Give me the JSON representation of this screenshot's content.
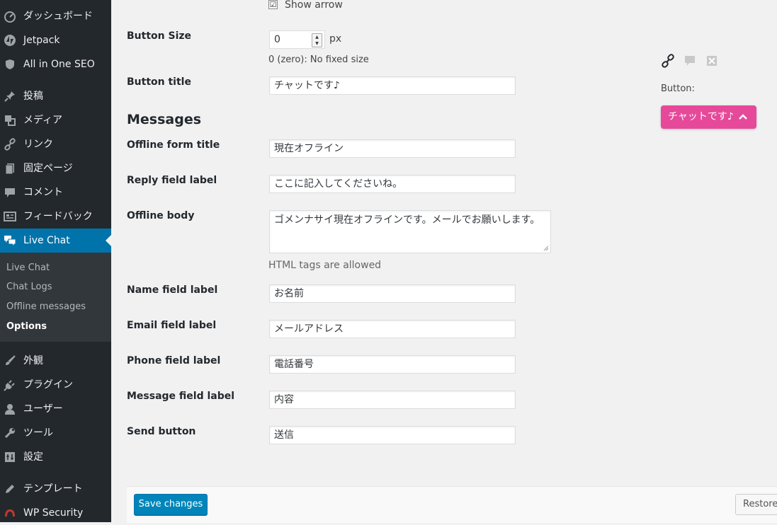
{
  "sidebar": {
    "items": [
      {
        "label": "ダッシュボード",
        "icon": "dashboard-icon"
      },
      {
        "label": "Jetpack",
        "icon": "jetpack-icon"
      },
      {
        "label": "All in One SEO",
        "icon": "shield-icon"
      },
      {
        "label": "投稿",
        "icon": "pushpin-icon"
      },
      {
        "label": "メディア",
        "icon": "media-icon"
      },
      {
        "label": "リンク",
        "icon": "link-icon"
      },
      {
        "label": "固定ページ",
        "icon": "page-icon"
      },
      {
        "label": "コメント",
        "icon": "comment-icon"
      },
      {
        "label": "フィードバック",
        "icon": "feedback-icon"
      },
      {
        "label": "Live Chat",
        "icon": "chat-bubbles-icon"
      },
      {
        "label": "外観",
        "icon": "brush-icon"
      },
      {
        "label": "プラグイン",
        "icon": "plug-icon"
      },
      {
        "label": "ユーザー",
        "icon": "user-icon"
      },
      {
        "label": "ツール",
        "icon": "wrench-icon"
      },
      {
        "label": "設定",
        "icon": "settings-icon"
      },
      {
        "label": "テンプレート",
        "icon": "pen-icon"
      },
      {
        "label": "WP Security",
        "icon": "security-icon"
      }
    ],
    "submenu": [
      "Live Chat",
      "Chat Logs",
      "Offline messages",
      "Options"
    ],
    "active_color": "#0073aa"
  },
  "form": {
    "show_arrow_label": "Show arrow",
    "show_arrow_checked": "☑",
    "button_size_label": "Button Size",
    "button_size_value": "0",
    "button_size_unit": "px",
    "button_size_hint": "0 (zero): No fixed size",
    "button_title_label": "Button title",
    "button_title_value": "チャットです♪",
    "messages_title": "Messages",
    "offline_form_title_label": "Offline form title",
    "offline_form_title_value": "現在オフライン",
    "reply_field_label": "Reply field label",
    "reply_field_value": "ここに記入してくださいね。",
    "offline_body_label": "Offline body",
    "offline_body_value": "ゴメンナサイ現在オフラインです。メールでお願いします。",
    "offline_body_hint": "HTML tags are allowed",
    "name_field_label": "Name field label",
    "name_field_value": "お名前",
    "email_field_label": "Email field label",
    "email_field_value": "メールアドレス",
    "phone_field_label": "Phone field label",
    "phone_field_value": "電話番号",
    "message_field_label": "Message field label",
    "message_field_value": "内容",
    "send_button_label": "Send button",
    "send_button_value": "送信"
  },
  "preview": {
    "button_label": "Button:",
    "chat_button_text": "チャットです♪",
    "chat_button_color": "#e6499a"
  },
  "footer": {
    "save_label": "Save changes",
    "restore_label": "Restore"
  }
}
